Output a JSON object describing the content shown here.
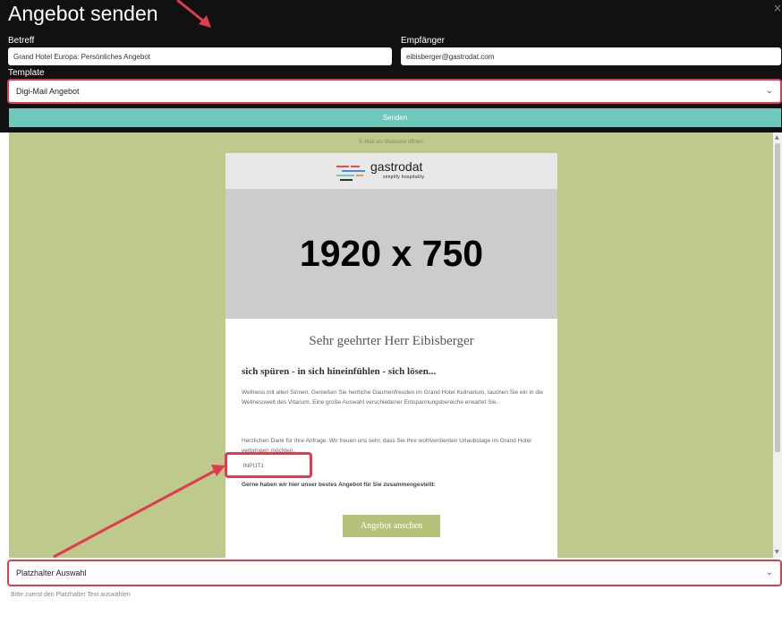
{
  "dialog": {
    "title": "Angebot senden",
    "close_icon": "×"
  },
  "form": {
    "subject_label": "Betreff",
    "subject_value": "Grand Hotel Europa: Persönliches Angebot",
    "recipient_label": "Empfänger",
    "recipient_value": "eibisberger@gastrodat.com",
    "template_label": "Template",
    "template_value": "Digi-Mail Angebot",
    "send_label": "Senden"
  },
  "preview": {
    "open_as_website": "E-Mail als Webseite öffnen",
    "logo_name": "gastrodat",
    "logo_tagline": "simplify hospitality",
    "hero_text": "1920 x 750",
    "salutation": "Sehr geehrter Herr Eibisberger",
    "headline": "sich spüren - in sich hineinfühlen - sich lösen...",
    "paragraph1": "Wellness mit allen Sinnen. Genießen Sie herrliche Gaumenfreuden im Grand Hotel Kulinarium, tauchen Sie ein in die Wellnesswelt des Vitarium. Eine große Auswahl verschiedener Entspannungsbereiche erwartet Sie.",
    "paragraph2": "Herzlichen Dank für Ihre Anfrage. Wir freuen uns sehr, dass Sie Ihre wohlverdienten Urlaubstage im Grand Hotel verbringen möchten.",
    "input_placeholder": ":INPUT1",
    "offer_intro": "Gerne haben wir hier unser bestes Angebot für Sie zusammengestellt:",
    "offer_button": "Angebot anschen"
  },
  "placeholder": {
    "select_value": "Platzhalter Auswahl",
    "hint": "Bitte zuerst den Platzhalter Text auswählen"
  },
  "icons": {
    "chevron": "chevron-down-icon",
    "close": "close-icon"
  },
  "colors": {
    "header_bg": "#111111",
    "send_button": "#6ec9bc",
    "preview_bg": "#bec98c",
    "annotation_red": "#e03b4f",
    "offer_button": "#b5c279"
  }
}
